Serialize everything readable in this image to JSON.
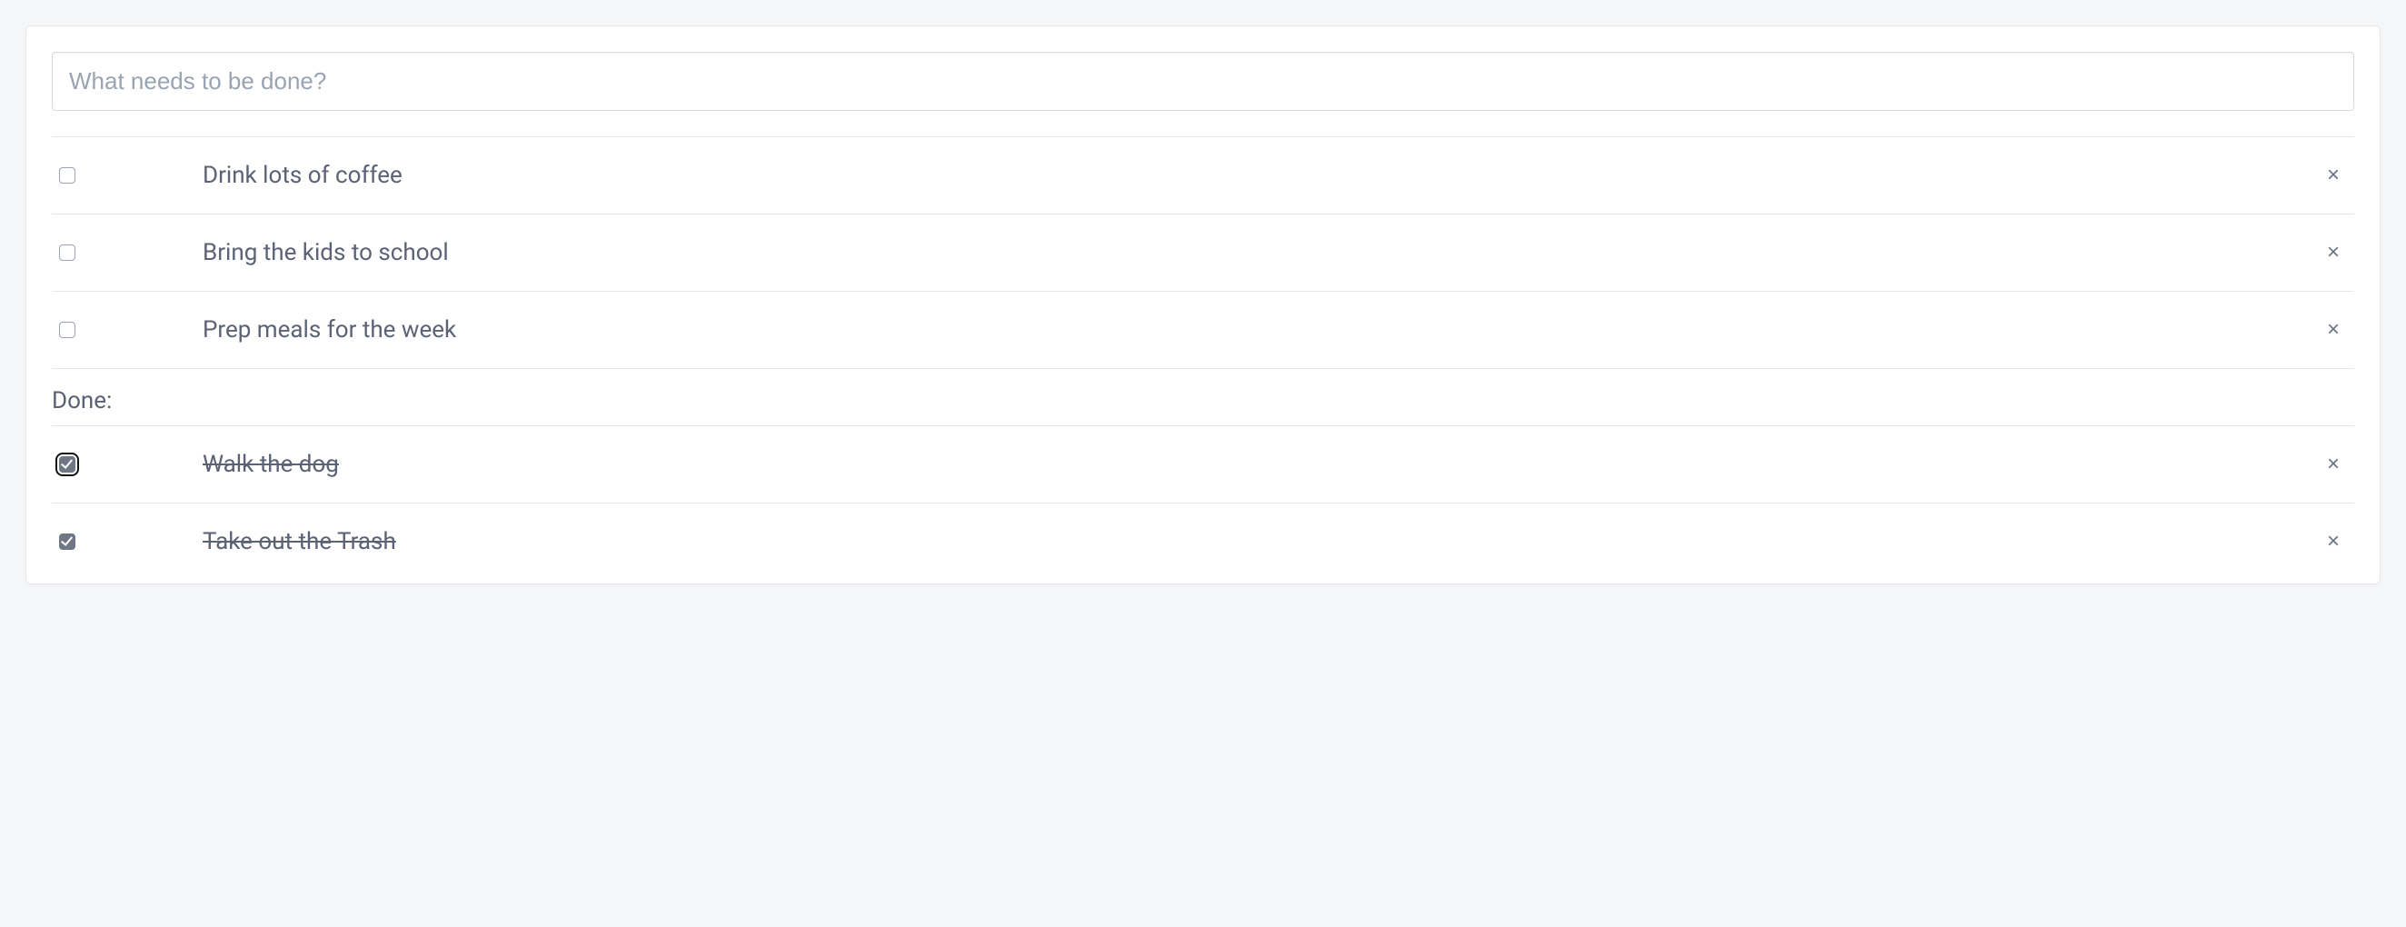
{
  "input": {
    "placeholder": "What needs to be done?"
  },
  "sections": {
    "done_label": "Done:"
  },
  "todos": [
    {
      "label": "Drink lots of coffee",
      "done": false,
      "focus": false
    },
    {
      "label": "Bring the kids to school",
      "done": false,
      "focus": false
    },
    {
      "label": "Prep meals for the week",
      "done": false,
      "focus": false
    }
  ],
  "done": [
    {
      "label": "Walk the dog",
      "done": true,
      "focus": true
    },
    {
      "label": "Take out the Trash",
      "done": true,
      "focus": false
    }
  ]
}
